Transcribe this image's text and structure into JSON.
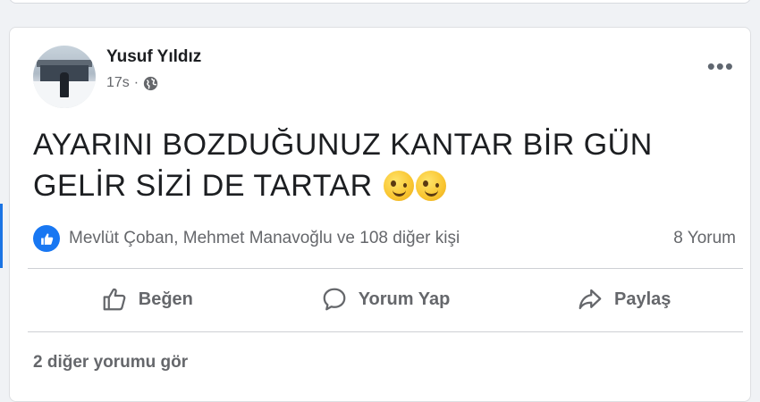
{
  "post": {
    "author": "Yusuf Yıldız",
    "time": "17s",
    "separator": "·",
    "audience_icon": "globe-icon",
    "more_label": "•••",
    "text_line1": "AYARINI BOZDUĞUNUZ KANTAR BİR GÜN",
    "text_line2": "GELİR SİZİ DE TARTAR",
    "emojis": [
      "winking-face",
      "winking-face"
    ]
  },
  "reactions": {
    "icon": "like-icon",
    "summary": "Mevlüt Çoban, Mehmet Manavoğlu ve 108 diğer kişi",
    "comments": "8 Yorum"
  },
  "actions": {
    "like": "Beğen",
    "comment": "Yorum Yap",
    "share": "Paylaş"
  },
  "more_comments": "2 diğer yorumu gör",
  "colors": {
    "accent": "#1877f2",
    "secondary_text": "#65676b",
    "background": "#f0f2f5"
  }
}
